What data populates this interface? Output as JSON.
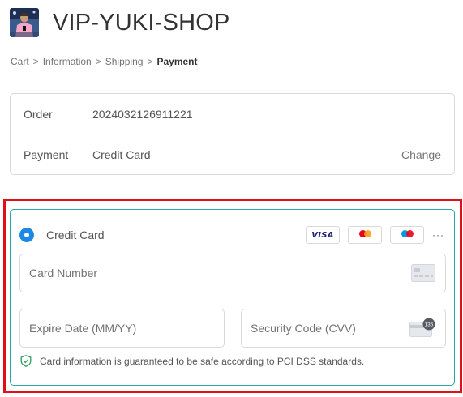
{
  "shop": {
    "name": "VIP-YUKI-SHOP"
  },
  "breadcrumb": {
    "items": [
      "Cart",
      "Information",
      "Shipping",
      "Payment"
    ],
    "separator": ">"
  },
  "summary": {
    "order_label": "Order",
    "order_value": "2024032126911221",
    "payment_label": "Payment",
    "payment_value": "Credit Card",
    "change_label": "Change"
  },
  "payment": {
    "method_label": "Credit Card",
    "card_brands": [
      "visa-logo",
      "mastercard-logo",
      "maestro-logo"
    ],
    "more_label": "···",
    "fields": {
      "card_number_placeholder": "Card Number",
      "expiry_placeholder": "Expire Date (MM/YY)",
      "cvv_placeholder": "Security Code (CVV)"
    },
    "cvv_icon_text": "135",
    "secure_note": "Card information is guaranteed to be safe according to PCI DSS standards."
  },
  "colors": {
    "accent_blue": "#1e88e5",
    "box_border_teal": "#2aa7a5",
    "highlight_red": "#e0101b",
    "shield_green": "#2e9e5b"
  }
}
